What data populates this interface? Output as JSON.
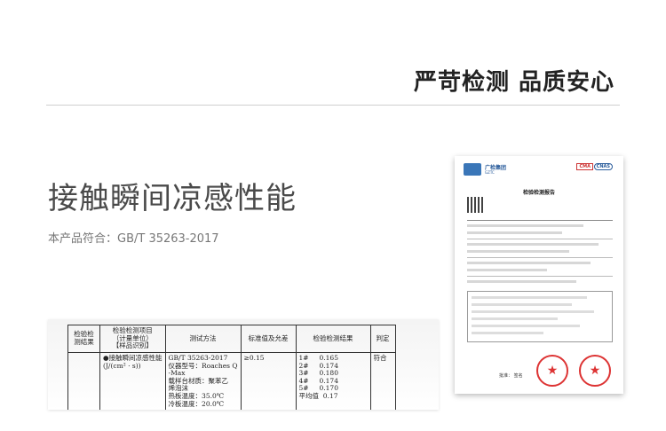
{
  "header": {
    "title": "严苛检测 品质安心"
  },
  "section": {
    "heading": "接触瞬间凉感性能",
    "standard": "本产品符合：GB/T 35263-2017"
  },
  "table": {
    "headers": {
      "item": "检验检测结果",
      "property": "检验检测项目\n（计量单位）\n【样品识别】",
      "method": "测试方法",
      "standard": "标准值及允差",
      "result": "检验检测结果",
      "verdict": "判定"
    },
    "row": {
      "property": "●接触瞬间凉感性能\n(J/(cm² · s))",
      "method": "GB/T 35263-2017\n仪器型号：Roaches Q\n-Max\n载样台材质：聚苯乙\n烯泡沫\n热板温度：35.0℃\n冷板温度：20.0℃",
      "standard": "≥0.15",
      "results": [
        "1#     0.165",
        "2#     0.174",
        "3#     0.180",
        "4#     0.174",
        "5#     0.170",
        "平均值  0.17"
      ],
      "verdict": "符合"
    }
  },
  "report": {
    "org": "广检集团",
    "org_sub": "GZTC",
    "cert_a": "CMA",
    "cert_b": "CNAS",
    "title": "检验检测报告",
    "sign": "批准：  签名"
  },
  "icons": [
    "report-logo-icon",
    "stamp-star-icon"
  ]
}
